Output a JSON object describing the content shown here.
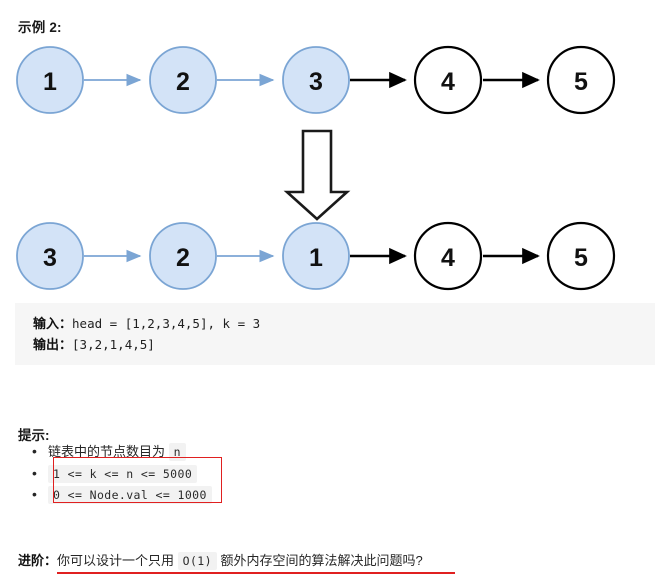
{
  "example": {
    "title": "示例 2:"
  },
  "diagram": {
    "before": {
      "nodes": [
        {
          "label": "1",
          "highlighted": true
        },
        {
          "label": "2",
          "highlighted": true
        },
        {
          "label": "3",
          "highlighted": true
        },
        {
          "label": "4",
          "highlighted": false
        },
        {
          "label": "5",
          "highlighted": false
        }
      ]
    },
    "after": {
      "nodes": [
        {
          "label": "3",
          "highlighted": true
        },
        {
          "label": "2",
          "highlighted": true
        },
        {
          "label": "1",
          "highlighted": true
        },
        {
          "label": "4",
          "highlighted": false
        },
        {
          "label": "5",
          "highlighted": false
        }
      ]
    },
    "transform_arrow": "down-block-arrow",
    "colors": {
      "node_fill_highlight": "#d3e3f7",
      "node_stroke_highlight": "#7ba5d4",
      "node_fill_plain": "#ffffff",
      "node_stroke_plain": "#000000",
      "arrow_highlight": "#7ba5d4",
      "arrow_plain": "#000000",
      "label_color": "#111111"
    }
  },
  "code_block": {
    "input_label": "输入：",
    "input_value": "head = [1,2,3,4,5], k = 3",
    "output_label": "输出：",
    "output_value": "[3,2,1,4,5]",
    "background": "#f6f6f6"
  },
  "hints": {
    "title": "提示:",
    "items": [
      {
        "text": "链表中的节点数目为 ",
        "code": "n",
        "trailing": ""
      },
      {
        "text": "",
        "code": "1 <= k <= n <= 5000",
        "trailing": ""
      },
      {
        "text": "",
        "code": "0 <= Node.val <= 1000",
        "trailing": ""
      }
    ],
    "annotation_color": "#e02020"
  },
  "followup": {
    "label": "进阶：",
    "text_before": "你可以设计一个只用 ",
    "code": "O(1)",
    "text_after": " 额外内存空间的算法解决此问题吗?",
    "underline_color": "#e02020"
  }
}
